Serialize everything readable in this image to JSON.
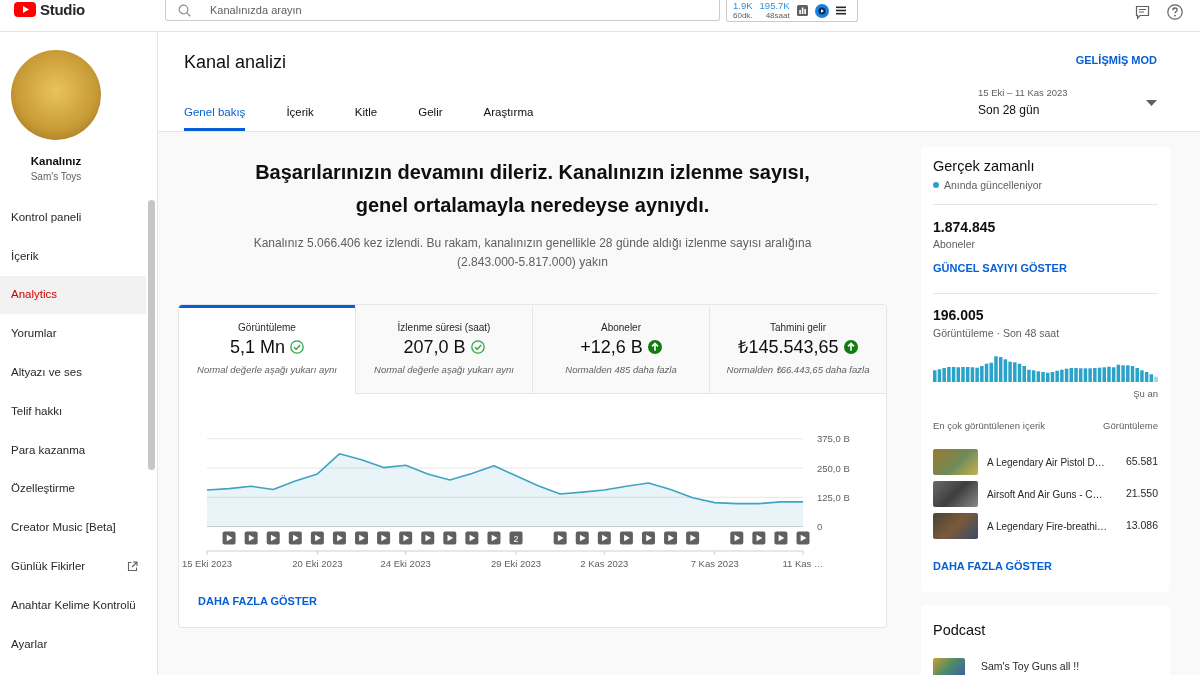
{
  "topbar": {
    "logo_text": "Studio",
    "search": {
      "placeholder": "Kanalınızda arayın"
    },
    "stats": [
      {
        "value": "1.9K",
        "period": "60dk."
      },
      {
        "value": "195.7K",
        "period": "48saat"
      }
    ]
  },
  "sidebar": {
    "channel_label": "Kanalınız",
    "channel_name": "Sam's Toys",
    "items": [
      {
        "label": "Kontrol paneli",
        "selected": false,
        "external": false
      },
      {
        "label": "İçerik",
        "selected": false,
        "external": false
      },
      {
        "label": "Analytics",
        "selected": true,
        "external": false
      },
      {
        "label": "Yorumlar",
        "selected": false,
        "external": false
      },
      {
        "label": "Altyazı ve ses",
        "selected": false,
        "external": false
      },
      {
        "label": "Telif hakkı",
        "selected": false,
        "external": false
      },
      {
        "label": "Para kazanma",
        "selected": false,
        "external": false
      },
      {
        "label": "Özelleştirme",
        "selected": false,
        "external": false
      },
      {
        "label": "Creator Music [Beta]",
        "selected": false,
        "external": false
      },
      {
        "label": "Günlük Fikirler",
        "selected": false,
        "external": true
      },
      {
        "label": "Anahtar Kelime Kontrolü",
        "selected": false,
        "external": false
      },
      {
        "label": "Ayarlar",
        "selected": false,
        "external": false
      }
    ]
  },
  "header": {
    "title": "Kanal analizi",
    "advanced_mode": "GELİŞMİŞ MOD",
    "tabs": [
      {
        "label": "Genel bakış",
        "selected": true
      },
      {
        "label": "İçerik",
        "selected": false
      },
      {
        "label": "Kitle",
        "selected": false
      },
      {
        "label": "Gelir",
        "selected": false
      },
      {
        "label": "Araştırma",
        "selected": false
      }
    ],
    "date_range": {
      "range": "15 Eki – 11 Kas 2023",
      "period": "Son 28 gün"
    }
  },
  "summary": {
    "headline": "Başarılarınızın devamını dileriz. Kanalınızın izlenme sayısı, genel ortalamayla neredeyse aynıydı.",
    "detail": "Kanalınız 5.066.406 kez izlendi. Bu rakam, kanalınızın genellikle 28 günde aldığı izlenme sayısı aralığına (2.843.000-5.817.000) yakın"
  },
  "main_card": {
    "metrics": [
      {
        "label": "Görüntüleme",
        "value": "5,1 Mn",
        "kind": "normal",
        "note": "Normal değerle aşağı yukarı aynı",
        "selected": true
      },
      {
        "label": "İzlenme süresi (saat)",
        "value": "207,0 B",
        "kind": "normal",
        "note": "Normal değerle aşağı yukarı aynı",
        "selected": false
      },
      {
        "label": "Aboneler",
        "value": "+12,6 B",
        "kind": "up",
        "note": "Normalden 485 daha fazla",
        "selected": false
      },
      {
        "label": "Tahmini gelir",
        "value": "₺145.543,65",
        "kind": "up",
        "note": "Normalden ₺66.443,65 daha fazla",
        "selected": false
      }
    ],
    "chart_data": {
      "type": "area",
      "categories": [
        "15 Eki 2023",
        null,
        null,
        null,
        null,
        "20 Eki 2023",
        null,
        null,
        null,
        "24 Eki 2023",
        null,
        null,
        null,
        null,
        "29 Eki 2023",
        null,
        null,
        null,
        "2 Kas 2023",
        null,
        null,
        null,
        null,
        "7 Kas 2023",
        null,
        null,
        null,
        "11 Kas …"
      ],
      "series": [
        {
          "color": "#3ea4c2",
          "values": [
            156,
            162,
            172,
            158,
            195,
            225,
            311,
            285,
            252,
            262,
            225,
            199,
            227,
            260,
            217,
            174,
            139,
            147,
            156,
            172,
            186,
            158,
            123,
            102,
            98,
            98,
            105,
            105
          ]
        }
      ],
      "ylim": [
        0,
        375
      ],
      "yticks": [
        {
          "value": 0,
          "label": "0"
        },
        {
          "value": 125,
          "label": "125,0 B"
        },
        {
          "value": 250,
          "label": "250,0 B"
        },
        {
          "value": 375,
          "label": "375,0 B"
        }
      ]
    },
    "upload_markers": [
      {
        "kind": "empty"
      },
      {
        "kind": "video"
      },
      {
        "kind": "video"
      },
      {
        "kind": "video"
      },
      {
        "kind": "video"
      },
      {
        "kind": "video"
      },
      {
        "kind": "video"
      },
      {
        "kind": "video"
      },
      {
        "kind": "video"
      },
      {
        "kind": "video"
      },
      {
        "kind": "video"
      },
      {
        "kind": "video"
      },
      {
        "kind": "video"
      },
      {
        "kind": "video"
      },
      {
        "kind": "count",
        "label": "2"
      },
      {
        "kind": "empty"
      },
      {
        "kind": "video"
      },
      {
        "kind": "video"
      },
      {
        "kind": "video"
      },
      {
        "kind": "video"
      },
      {
        "kind": "video"
      },
      {
        "kind": "video"
      },
      {
        "kind": "video"
      },
      {
        "kind": "empty"
      },
      {
        "kind": "video"
      },
      {
        "kind": "video"
      },
      {
        "kind": "video"
      },
      {
        "kind": "video"
      }
    ],
    "more_link": "DAHA FAZLA GÖSTER"
  },
  "realtime": {
    "title": "Gerçek zamanlı",
    "status": "Anında güncelleniyor",
    "subscribers": {
      "value": "1.874.845",
      "label": "Aboneler",
      "link": "GÜNCEL SAYIYI GÖSTER"
    },
    "views": {
      "value": "196.005",
      "label": "Görüntüleme · Son 48 saat",
      "now_label": "Şu an"
    },
    "top_content": {
      "heading": "En çok görüntülenen içerik",
      "column": "Görüntüleme",
      "rows": [
        {
          "title": "A Legendary Air Pistol D…",
          "views": "65.581"
        },
        {
          "title": "Airsoft And Air Guns - C…",
          "views": "21.550"
        },
        {
          "title": "A Legendary Fire-breathi…",
          "views": "13.086"
        }
      ]
    },
    "more_link": "DAHA FAZLA GÖSTER"
  },
  "podcast": {
    "title": "Podcast",
    "items": [
      {
        "title": "Sam's Toy Guns all !!"
      }
    ]
  }
}
